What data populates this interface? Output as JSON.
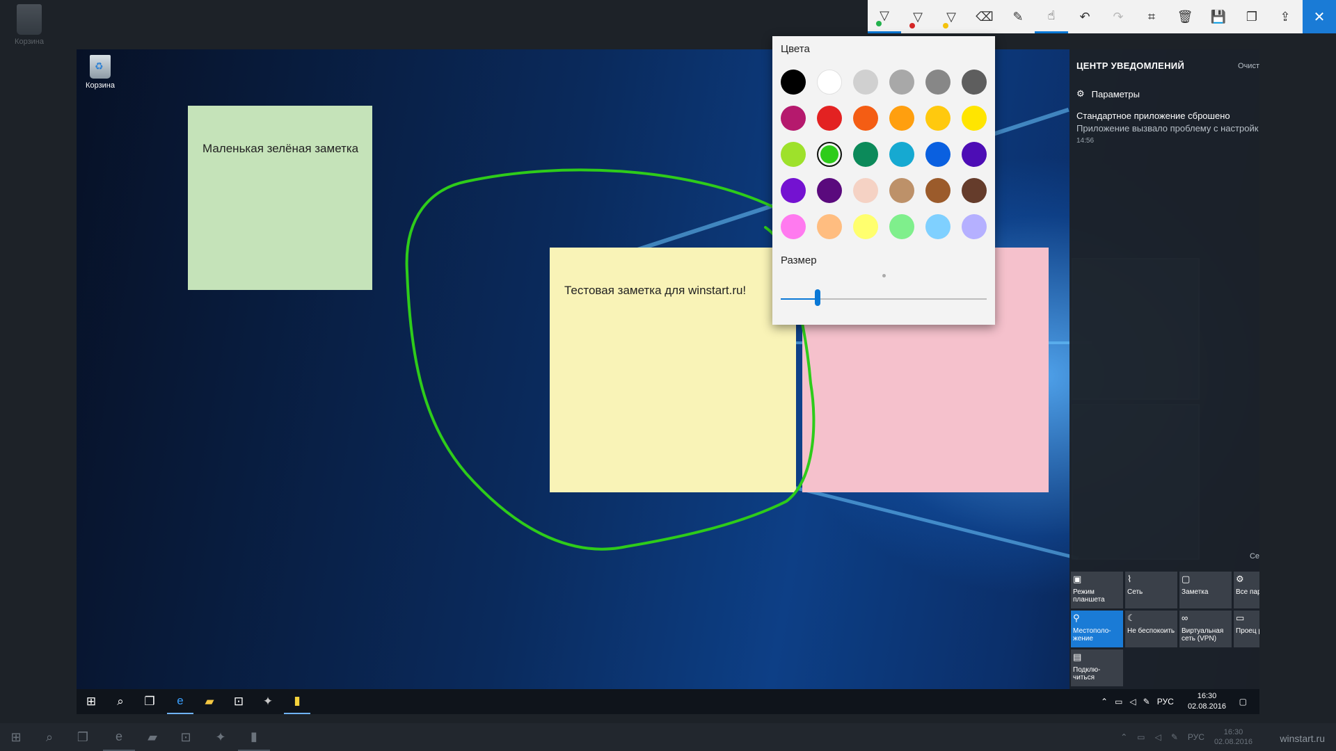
{
  "outer_desktop": {
    "recycle_label": "Корзина"
  },
  "inner_desktop": {
    "recycle_label": "Корзина"
  },
  "notes": {
    "green": "Маленькая зелёная заметка",
    "yellow": "Тестовая заметка для winstart.ru!",
    "pink": ""
  },
  "ink_color": "#2ecc1a",
  "toolbar": {
    "pens": [
      {
        "name": "ballpoint-pen",
        "color": "#22b14c"
      },
      {
        "name": "pencil",
        "color": "#d42626"
      },
      {
        "name": "highlighter",
        "color": "#f4c20d"
      }
    ],
    "accent": "#0a78d6"
  },
  "flyout": {
    "colors_title": "Цвета",
    "size_title": "Размер",
    "size_value": 0.18,
    "selected_color": "#2ecc1a",
    "swatches": [
      "#000000",
      "#ffffff",
      "#d0d0d0",
      "#a8a8a8",
      "#878787",
      "#5e5e5e",
      "#b5196d",
      "#e32222",
      "#f45d14",
      "#ff9f0f",
      "#ffc90e",
      "#ffe500",
      "#9ee12b",
      "#2ecc1a",
      "#0c8a5a",
      "#16a9d1",
      "#0a60e0",
      "#4d0db5",
      "#7412d1",
      "#5a0a7d",
      "#f5d2c4",
      "#bd9169",
      "#9b5b2b",
      "#653c2b",
      "#ff7aef",
      "#ffbd80",
      "#ffff6e",
      "#7fef8c",
      "#7fd0ff",
      "#b5b0ff"
    ]
  },
  "action_center": {
    "title": "ЦЕНТР УВЕДОМЛЕНИЙ",
    "clear": "Очист",
    "params": "Параметры",
    "notification_title": "Стандартное приложение сброшено",
    "notification_body": "Приложение вызвало проблему с настройк",
    "notification_time": "14:56",
    "collapse": "Се",
    "tiles": [
      {
        "label": "Режим планшета",
        "icon": "▣",
        "active": false
      },
      {
        "label": "Сеть",
        "icon": "⌇",
        "active": false
      },
      {
        "label": "Заметка",
        "icon": "▢",
        "active": false
      },
      {
        "label": "Все парам",
        "icon": "⚙",
        "active": false
      },
      {
        "label": "Местополо-жение",
        "icon": "⚲",
        "active": true
      },
      {
        "label": "Не беспокоить",
        "icon": "☾",
        "active": false
      },
      {
        "label": "Виртуальная сеть (VPN)",
        "icon": "∞",
        "active": false
      },
      {
        "label": "Проец ровать",
        "icon": "▭",
        "active": false
      },
      {
        "label": "Подклю-читься",
        "icon": "▤",
        "active": false
      }
    ]
  },
  "taskbar": {
    "lang": "РУС",
    "time": "16:30",
    "date": "02.08.2016"
  },
  "outer_taskbar": {
    "lang": "РУС",
    "time": "16:30",
    "date": "02.08.2016"
  },
  "watermark": "winstart.ru"
}
